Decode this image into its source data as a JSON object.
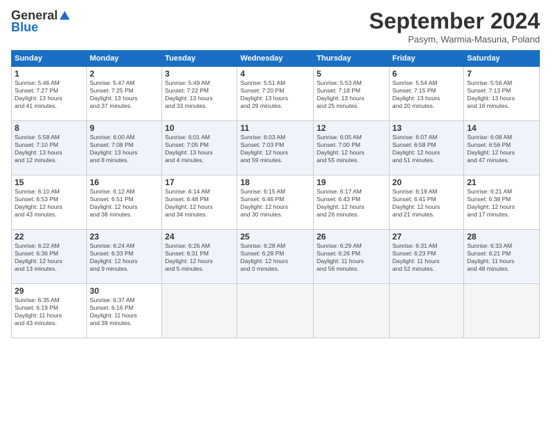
{
  "logo": {
    "general": "General",
    "blue": "Blue"
  },
  "header": {
    "title": "September 2024",
    "subtitle": "Pasym, Warmia-Masuria, Poland"
  },
  "days_of_week": [
    "Sunday",
    "Monday",
    "Tuesday",
    "Wednesday",
    "Thursday",
    "Friday",
    "Saturday"
  ],
  "weeks": [
    [
      {
        "day": "1",
        "info": "Sunrise: 5:46 AM\nSunset: 7:27 PM\nDaylight: 13 hours\nand 41 minutes."
      },
      {
        "day": "2",
        "info": "Sunrise: 5:47 AM\nSunset: 7:25 PM\nDaylight: 13 hours\nand 37 minutes."
      },
      {
        "day": "3",
        "info": "Sunrise: 5:49 AM\nSunset: 7:22 PM\nDaylight: 13 hours\nand 33 minutes."
      },
      {
        "day": "4",
        "info": "Sunrise: 5:51 AM\nSunset: 7:20 PM\nDaylight: 13 hours\nand 29 minutes."
      },
      {
        "day": "5",
        "info": "Sunrise: 5:53 AM\nSunset: 7:18 PM\nDaylight: 13 hours\nand 25 minutes."
      },
      {
        "day": "6",
        "info": "Sunrise: 5:54 AM\nSunset: 7:15 PM\nDaylight: 13 hours\nand 20 minutes."
      },
      {
        "day": "7",
        "info": "Sunrise: 5:56 AM\nSunset: 7:13 PM\nDaylight: 13 hours\nand 16 minutes."
      }
    ],
    [
      {
        "day": "8",
        "info": "Sunrise: 5:58 AM\nSunset: 7:10 PM\nDaylight: 13 hours\nand 12 minutes."
      },
      {
        "day": "9",
        "info": "Sunrise: 6:00 AM\nSunset: 7:08 PM\nDaylight: 13 hours\nand 8 minutes."
      },
      {
        "day": "10",
        "info": "Sunrise: 6:01 AM\nSunset: 7:05 PM\nDaylight: 13 hours\nand 4 minutes."
      },
      {
        "day": "11",
        "info": "Sunrise: 6:03 AM\nSunset: 7:03 PM\nDaylight: 12 hours\nand 59 minutes."
      },
      {
        "day": "12",
        "info": "Sunrise: 6:05 AM\nSunset: 7:00 PM\nDaylight: 12 hours\nand 55 minutes."
      },
      {
        "day": "13",
        "info": "Sunrise: 6:07 AM\nSunset: 6:58 PM\nDaylight: 12 hours\nand 51 minutes."
      },
      {
        "day": "14",
        "info": "Sunrise: 6:08 AM\nSunset: 6:56 PM\nDaylight: 12 hours\nand 47 minutes."
      }
    ],
    [
      {
        "day": "15",
        "info": "Sunrise: 6:10 AM\nSunset: 6:53 PM\nDaylight: 12 hours\nand 43 minutes."
      },
      {
        "day": "16",
        "info": "Sunrise: 6:12 AM\nSunset: 6:51 PM\nDaylight: 12 hours\nand 38 minutes."
      },
      {
        "day": "17",
        "info": "Sunrise: 6:14 AM\nSunset: 6:48 PM\nDaylight: 12 hours\nand 34 minutes."
      },
      {
        "day": "18",
        "info": "Sunrise: 6:15 AM\nSunset: 6:46 PM\nDaylight: 12 hours\nand 30 minutes."
      },
      {
        "day": "19",
        "info": "Sunrise: 6:17 AM\nSunset: 6:43 PM\nDaylight: 12 hours\nand 26 minutes."
      },
      {
        "day": "20",
        "info": "Sunrise: 6:19 AM\nSunset: 6:41 PM\nDaylight: 12 hours\nand 21 minutes."
      },
      {
        "day": "21",
        "info": "Sunrise: 6:21 AM\nSunset: 6:38 PM\nDaylight: 12 hours\nand 17 minutes."
      }
    ],
    [
      {
        "day": "22",
        "info": "Sunrise: 6:22 AM\nSunset: 6:36 PM\nDaylight: 12 hours\nand 13 minutes."
      },
      {
        "day": "23",
        "info": "Sunrise: 6:24 AM\nSunset: 6:33 PM\nDaylight: 12 hours\nand 9 minutes."
      },
      {
        "day": "24",
        "info": "Sunrise: 6:26 AM\nSunset: 6:31 PM\nDaylight: 12 hours\nand 5 minutes."
      },
      {
        "day": "25",
        "info": "Sunrise: 6:28 AM\nSunset: 6:28 PM\nDaylight: 12 hours\nand 0 minutes."
      },
      {
        "day": "26",
        "info": "Sunrise: 6:29 AM\nSunset: 6:26 PM\nDaylight: 11 hours\nand 56 minutes."
      },
      {
        "day": "27",
        "info": "Sunrise: 6:31 AM\nSunset: 6:23 PM\nDaylight: 11 hours\nand 52 minutes."
      },
      {
        "day": "28",
        "info": "Sunrise: 6:33 AM\nSunset: 6:21 PM\nDaylight: 11 hours\nand 48 minutes."
      }
    ],
    [
      {
        "day": "29",
        "info": "Sunrise: 6:35 AM\nSunset: 6:19 PM\nDaylight: 11 hours\nand 43 minutes."
      },
      {
        "day": "30",
        "info": "Sunrise: 6:37 AM\nSunset: 6:16 PM\nDaylight: 11 hours\nand 39 minutes."
      },
      {
        "day": "",
        "info": ""
      },
      {
        "day": "",
        "info": ""
      },
      {
        "day": "",
        "info": ""
      },
      {
        "day": "",
        "info": ""
      },
      {
        "day": "",
        "info": ""
      }
    ]
  ]
}
